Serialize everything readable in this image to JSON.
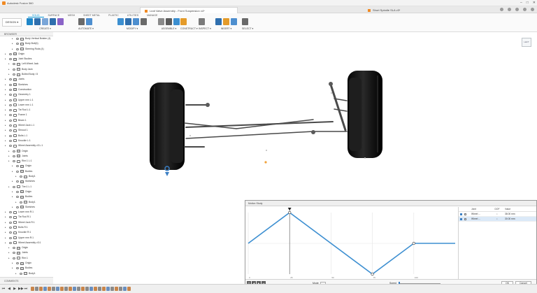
{
  "window": {
    "app_title": "Autodesk Fusion 360",
    "controls": [
      "–",
      "□",
      "✕"
    ]
  },
  "tabs": [
    {
      "label": "Leaf Valve Assembly - Front Suspension v4*"
    },
    {
      "label": "Short Spindle SLA v3*"
    }
  ],
  "ribbon": {
    "workspace": "DESIGN ▾",
    "tabs": [
      "SOLID",
      "SURFACE",
      "MESH",
      "SHEET METAL",
      "PLASTIC",
      "UTILITIES",
      "MANAGE"
    ],
    "active_tab_index": 0,
    "groups": [
      {
        "label": "CREATE ▾",
        "icon_colors": [
          "#1f86c8",
          "#2f6fae",
          "#7aa6d8",
          "#2f6fae",
          "#8a63c7"
        ]
      },
      {
        "label": "AUTOMATE ▾",
        "icon_colors": [
          "#6a6a6a",
          "#4e8fcf"
        ]
      },
      {
        "label": "MODIFY ▾",
        "icon_colors": [
          "#3c8fd0",
          "#2f6fae",
          "#4e8fcf",
          "#6a6a6a"
        ]
      },
      {
        "label": "ASSEMBLE ▾",
        "icon_colors": [
          "#8a8a8a",
          "#5b5b5b",
          "#3c8fd0"
        ]
      },
      {
        "label": "CONSTRUCT ▾",
        "icon_colors": [
          "#e49b2a"
        ]
      },
      {
        "label": "INSPECT ▾",
        "icon_colors": [
          "#7a7a7a"
        ]
      },
      {
        "label": "INSERT ▾",
        "icon_colors": [
          "#2f6fae",
          "#e49b2a",
          "#4e8fcf"
        ]
      },
      {
        "label": "SELECT ▾",
        "icon_colors": [
          "#6a6a6a"
        ]
      }
    ]
  },
  "browser": {
    "title": "BROWSER",
    "rows": [
      {
        "indent": 3,
        "icon": "body",
        "label": "Body Vertical Bolster (4)"
      },
      {
        "indent": 3,
        "icon": "body",
        "label": "Body Bolt(4)"
      },
      {
        "indent": 3,
        "icon": "body",
        "label": "Steering Rods (4)"
      },
      {
        "indent": 1,
        "icon": "folder",
        "label": "Origin"
      },
      {
        "indent": 1,
        "icon": "folder",
        "label": "Joint Studies"
      },
      {
        "indent": 2,
        "icon": "body",
        "label": "Left Wheel Jack"
      },
      {
        "indent": 2,
        "icon": "body",
        "label": "Body Jack"
      },
      {
        "indent": 2,
        "icon": "body",
        "label": "Bolted Body / 8"
      },
      {
        "indent": 1,
        "icon": "folder",
        "label": "Joints"
      },
      {
        "indent": 1,
        "icon": "folder",
        "label": "Sketches"
      },
      {
        "indent": 1,
        "icon": "folder",
        "label": "Construction"
      },
      {
        "indent": 1,
        "icon": "comp",
        "label": "Geometry 1"
      },
      {
        "indent": 1,
        "icon": "comp",
        "label": "Upper mm L:1"
      },
      {
        "indent": 1,
        "icon": "comp",
        "label": "Lower mm L:1"
      },
      {
        "indent": 1,
        "icon": "comp",
        "label": "Tie Rod L:1"
      },
      {
        "indent": 1,
        "icon": "comp",
        "label": "Frame 1"
      },
      {
        "indent": 1,
        "icon": "comp",
        "label": "Beam 1"
      },
      {
        "indent": 1,
        "icon": "comp",
        "label": "Wheel Jack L:1"
      },
      {
        "indent": 1,
        "icon": "comp",
        "label": "Shroud 1"
      },
      {
        "indent": 1,
        "icon": "comp",
        "label": "Bolts L:1"
      },
      {
        "indent": 1,
        "icon": "comp",
        "label": "Knuckle L:1"
      },
      {
        "indent": 1,
        "icon": "comp",
        "label": "Wheel Assembly v3 L:1"
      },
      {
        "indent": 2,
        "icon": "folder",
        "label": "Origin"
      },
      {
        "indent": 2,
        "icon": "folder",
        "label": "Joints"
      },
      {
        "indent": 2,
        "icon": "comp",
        "label": "Rim:1 L:1"
      },
      {
        "indent": 3,
        "icon": "folder",
        "label": "Origin"
      },
      {
        "indent": 3,
        "icon": "folder",
        "label": "Bodies"
      },
      {
        "indent": 4,
        "icon": "body",
        "label": "Body1"
      },
      {
        "indent": 3,
        "icon": "folder",
        "label": "Sketches"
      },
      {
        "indent": 2,
        "icon": "comp",
        "label": "Tire:1 L:1"
      },
      {
        "indent": 3,
        "icon": "folder",
        "label": "Origin"
      },
      {
        "indent": 3,
        "icon": "folder",
        "label": "Bodies"
      },
      {
        "indent": 4,
        "icon": "body",
        "label": "Body1"
      },
      {
        "indent": 3,
        "icon": "folder",
        "label": "Sketches"
      },
      {
        "indent": 1,
        "icon": "comp",
        "label": "Lower mm R:1"
      },
      {
        "indent": 1,
        "icon": "comp",
        "label": "Tie Rod R:1"
      },
      {
        "indent": 1,
        "icon": "comp",
        "label": "Wheel Jack R:1"
      },
      {
        "indent": 1,
        "icon": "comp",
        "label": "Bolts R:1"
      },
      {
        "indent": 1,
        "icon": "comp",
        "label": "Knuckle R:1"
      },
      {
        "indent": 1,
        "icon": "comp",
        "label": "Upper mm R:1"
      },
      {
        "indent": 1,
        "icon": "comp",
        "label": "Wheel Assembly v3:1"
      },
      {
        "indent": 2,
        "icon": "folder",
        "label": "Origin"
      },
      {
        "indent": 2,
        "icon": "folder",
        "label": "Joints"
      },
      {
        "indent": 2,
        "icon": "comp",
        "label": "Rim:1"
      },
      {
        "indent": 3,
        "icon": "folder",
        "label": "Origin"
      },
      {
        "indent": 3,
        "icon": "folder",
        "label": "Bodies"
      },
      {
        "indent": 4,
        "icon": "body",
        "label": "Body1"
      }
    ]
  },
  "comments": {
    "label": "COMMENTS"
  },
  "viewcube": {
    "label": "LEFT"
  },
  "motion_study": {
    "title": "Motion Study",
    "table": {
      "headers": [
        "",
        "",
        "Joint",
        "DOF",
        "Value"
      ],
      "rows": [
        {
          "color": "#3b7fc4",
          "joint": "Wheel ...",
          "dof": "↕",
          "value": "38.00 mm",
          "selected": false
        },
        {
          "color": "#3b7fc4",
          "joint": "Wheel ...",
          "dof": "↕",
          "value": "30.00 mm",
          "selected": true
        }
      ]
    },
    "graph": {
      "line_color": "#3d8fd1",
      "points": [
        [
          0,
          50
        ],
        [
          25,
          100
        ],
        [
          75,
          0
        ],
        [
          100,
          50
        ],
        [
          125,
          50
        ]
      ],
      "keyframes": [
        1,
        2,
        3
      ],
      "x_ticks": [
        "0",
        "25",
        "50",
        "75",
        "100"
      ]
    },
    "controls": [
      "⏮",
      "◀",
      "▶",
      "⏭"
    ],
    "mode_label": "Mode",
    "speed_label": "Speed",
    "ok_label": "OK",
    "cancel_label": "Cancel"
  },
  "timeline": {
    "controls": [
      "⏮",
      "◀",
      "▶",
      "▶▶",
      "⏭"
    ],
    "feature_colors": [
      "#c9854a",
      "#8a8a8a",
      "#c9854a",
      "#6a8fbf",
      "#c9854a",
      "#8a8a8a",
      "#6a8fbf",
      "#c9854a",
      "#8a8a8a",
      "#c9854a",
      "#6a8fbf",
      "#8a8a8a",
      "#c9854a",
      "#8a8a8a",
      "#6a8fbf",
      "#c9854a",
      "#8a8a8a",
      "#c9854a",
      "#6a8fbf",
      "#8a8a8a",
      "#c9854a",
      "#8a8a8a",
      "#6a8fbf",
      "#c9854a"
    ]
  }
}
